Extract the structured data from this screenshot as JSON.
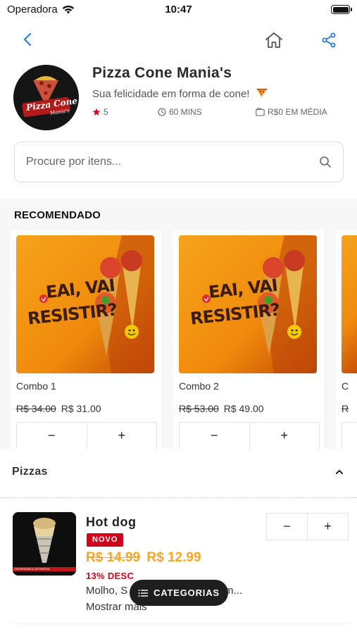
{
  "status_bar": {
    "carrier": "Operadora",
    "time": "10:47"
  },
  "store": {
    "name": "Pizza Cone Mania's",
    "tagline": "Sua felicidade em forma de cone!",
    "logo_text": "Pizza Cone",
    "logo_subtext": "Mania's",
    "rating": "5",
    "delivery_time": "60 MINS",
    "avg_price": "R$0 EM MÉDIA"
  },
  "search": {
    "placeholder": "Procure por itens..."
  },
  "recommended": {
    "title": "RECOMENDADO",
    "promo_text_line1": "EAI, VAI",
    "promo_text_line2": "RESISTIR?",
    "items": [
      {
        "name": "Combo 1",
        "old_price": "R$ 34.00",
        "price": "R$ 31.00"
      },
      {
        "name": "Combo 2",
        "old_price": "R$ 53.00",
        "price": "R$ 49.00"
      },
      {
        "name": "C",
        "old_price": "R",
        "price": ""
      }
    ],
    "minus_label": "−",
    "plus_label": "+"
  },
  "category": {
    "title": "Pizzas"
  },
  "product": {
    "name": "Hot dog",
    "badge": "NOVO",
    "old_price": "R$ 14.99",
    "price": "R$ 12.99",
    "discount": "13% DESC",
    "description": "Molho, S",
    "description_tail": "Tom...",
    "show_more": "Mostrar mais",
    "image_caption": "NDERSHAW ILUSTRATIVA"
  },
  "categories_button": {
    "label": "CATEGORIAS"
  },
  "colors": {
    "accent_blue": "#2a7de1",
    "price_orange": "#f5a623",
    "badge_red": "#d0021b",
    "rating_star": "#c8102e",
    "pill_dark": "#1e1e1e"
  },
  "icons": [
    "wifi-icon",
    "battery-icon",
    "back-arrow-icon",
    "home-icon",
    "share-icon",
    "star-icon",
    "clock-icon",
    "wallet-icon",
    "search-icon",
    "chevron-up-icon",
    "list-icon"
  ]
}
